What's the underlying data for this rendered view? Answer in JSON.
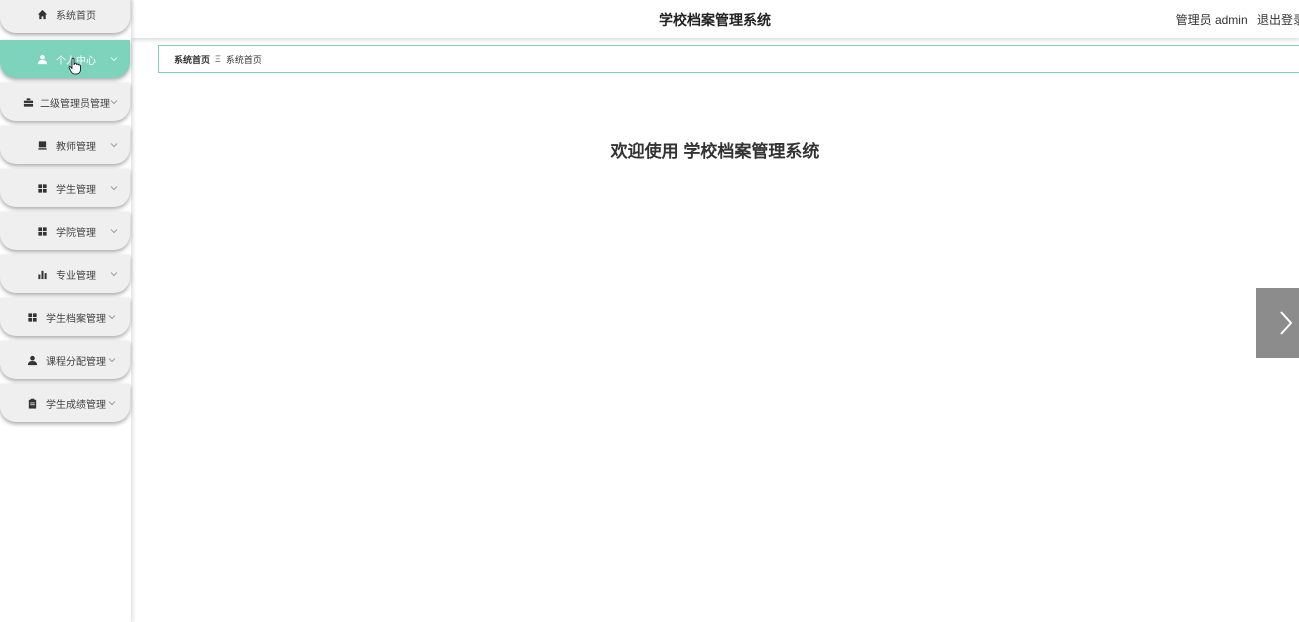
{
  "app": {
    "title": "学校档案管理系统"
  },
  "header": {
    "user_label": "管理员 admin",
    "logout_label": "退出登录"
  },
  "sidebar": {
    "accent_color": "#7dd3bb",
    "items": [
      {
        "label": "系统首页",
        "icon": "home-icon",
        "active": false,
        "has_submenu": false
      },
      {
        "label": "个人中心",
        "icon": "user-icon",
        "active": true,
        "has_submenu": true
      },
      {
        "label": "二级管理员管理",
        "icon": "briefcase-icon",
        "active": false,
        "has_submenu": true
      },
      {
        "label": "教师管理",
        "icon": "monitor-icon",
        "active": false,
        "has_submenu": true
      },
      {
        "label": "学生管理",
        "icon": "grid-icon",
        "active": false,
        "has_submenu": true
      },
      {
        "label": "学院管理",
        "icon": "grid-icon",
        "active": false,
        "has_submenu": true
      },
      {
        "label": "专业管理",
        "icon": "bar-chart-icon",
        "active": false,
        "has_submenu": true
      },
      {
        "label": "学生档案管理",
        "icon": "grid-icon",
        "active": false,
        "has_submenu": true
      },
      {
        "label": "课程分配管理",
        "icon": "user-icon",
        "active": false,
        "has_submenu": true
      },
      {
        "label": "学生成绩管理",
        "icon": "clipboard-icon",
        "active": false,
        "has_submenu": true
      }
    ]
  },
  "breadcrumb": {
    "home": "系统首页",
    "separator": "Ξ",
    "current": "系统首页"
  },
  "main": {
    "welcome": "欢迎使用 学校档案管理系统"
  }
}
